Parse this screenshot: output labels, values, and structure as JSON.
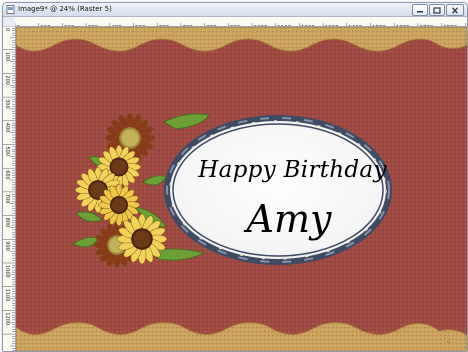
{
  "window": {
    "title": "Image9* @  24% (Raster 5)",
    "app_icon": "document-icon",
    "buttons": [
      "minimize-icon",
      "maximize-icon",
      "close-icon"
    ]
  },
  "ruler": {
    "top_labels": [
      "0",
      "100",
      "200",
      "300",
      "400",
      "500",
      "600",
      "700",
      "800",
      "900",
      "1000",
      "1100",
      "1200",
      "1300",
      "1400",
      "1500",
      "1600",
      "1700",
      "1800"
    ],
    "left_labels": [
      "0",
      "100",
      "200",
      "300",
      "400",
      "500",
      "600",
      "700",
      "800",
      "900",
      "1000",
      "1100",
      "1200"
    ]
  },
  "card": {
    "greeting": "Happy Birthday",
    "name": "Amy",
    "decorations": [
      "sunflower-icon",
      "leaf-icon",
      "oval-frame"
    ]
  },
  "colors": {
    "background_red": "#9e4a42",
    "border_tan": "#c9a25e",
    "frame_navy": "#3f4b63",
    "petal_yellow": "#f2d35a",
    "leaf_green": "#6aa035"
  }
}
